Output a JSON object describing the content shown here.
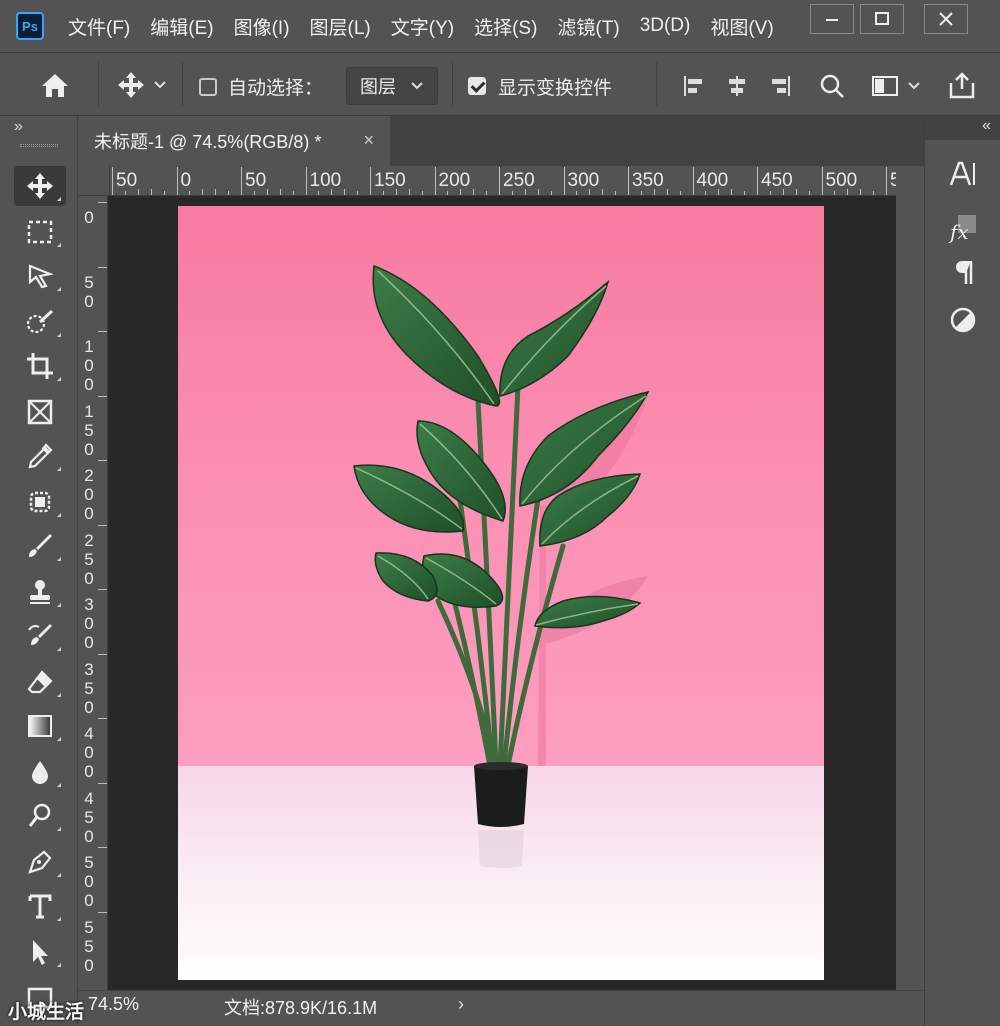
{
  "app": {
    "logo": "Ps"
  },
  "menu": {
    "items": [
      "文件(F)",
      "编辑(E)",
      "图像(I)",
      "图层(L)",
      "文字(Y)",
      "选择(S)",
      "滤镜(T)",
      "3D(D)",
      "视图(V)"
    ]
  },
  "options": {
    "auto_select_label": "自动选择：",
    "auto_select_checked": false,
    "layer_select_value": "图层",
    "show_transform_label": "显示变换控件",
    "show_transform_checked": true
  },
  "document": {
    "tab_title": "未标题-1 @ 74.5%(RGB/8) *",
    "close_glyph": "×"
  },
  "rulers": {
    "horizontal_labels": [
      "50",
      "0",
      "50",
      "100",
      "150",
      "200",
      "250",
      "300",
      "350",
      "400",
      "450",
      "500",
      "5"
    ],
    "vertical_labels": [
      "0",
      "5 0",
      "1 0 0",
      "1 5 0",
      "2 0 0",
      "2 5 0",
      "3 0 0",
      "3 5 0",
      "4 0 0",
      "4 5 0",
      "5 0 0",
      "5 5 0"
    ]
  },
  "status": {
    "zoom": "74.5%",
    "doc_info": "文档:878.9K/16.1M",
    "chevron": "›"
  },
  "dock": {
    "collapse_left": "»",
    "collapse_right": "«"
  },
  "watermark": {
    "text": "小城生活"
  },
  "colors": {
    "ui_bg": "#535353",
    "pasteboard": "#282828",
    "wall_pink": "#f77ba0",
    "floor": "#fbeef4",
    "leaf_green": "#2e6b3a",
    "pot": "#1c1c1c"
  },
  "tools": [
    "move-tool",
    "marquee-tool",
    "lasso-tool",
    "quick-selection-tool",
    "crop-tool",
    "frame-tool",
    "eyedropper-tool",
    "healing-brush-tool",
    "brush-tool",
    "clone-stamp-tool",
    "history-brush-tool",
    "eraser-tool",
    "gradient-tool",
    "blur-tool",
    "dodge-tool",
    "pen-tool",
    "type-tool",
    "path-selection-tool",
    "rectangle-tool"
  ]
}
